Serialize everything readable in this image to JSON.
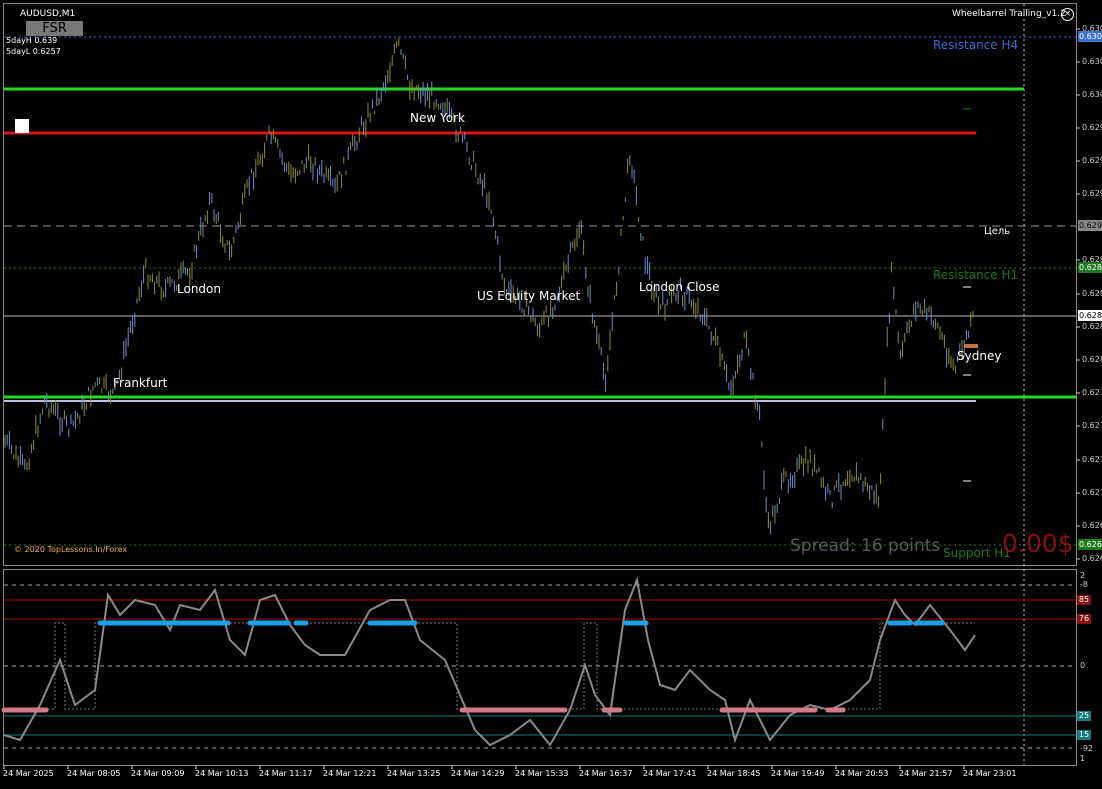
{
  "symbol": "AUDUSD,M1",
  "fsr_button": "FSR",
  "day_info": [
    "5dayH 0.639",
    "5dayL 0.6257"
  ],
  "ea": {
    "title": "Wheelbarrel Trailing_v1.2",
    "close_glyph": "×"
  },
  "levels": {
    "resistance_h4": "Resistance H4",
    "target": "Цель",
    "resistance_h1": "Resistance H1",
    "support_h1": "Support H1"
  },
  "sessions": [
    "New York",
    "London",
    "US Equity Market",
    "London Close",
    "Frankfurt",
    "Sydney"
  ],
  "copyright": "© 2020 TopLessons.In/Forex",
  "spread_text": "Spread: 16 points",
  "profit_text": "0.00$",
  "price_scale": [
    "0.630",
    "0.630",
    "0.630",
    "0.629",
    "0.629",
    "0.629",
    "0.628",
    "0.628",
    "0.628",
    "0.628",
    "0.627",
    "0.627",
    "0.627",
    "0.627",
    "0.626",
    "0.626"
  ],
  "price_tags": {
    "resistance_h4": "0.630",
    "target": "0.629",
    "resistance_h1": "0.628",
    "bid": "0.628",
    "support_h1": "0.626"
  },
  "indicator_scale": [
    "2",
    "-8",
    "0",
    "-92",
    "1"
  ],
  "indicator_levels": [
    "85",
    "76",
    "25",
    "15"
  ],
  "time_labels": [
    "24 Mar 2025",
    "24 Mar 08:05",
    "24 Mar 09:09",
    "24 Mar 10:13",
    "24 Mar 11:17",
    "24 Mar 12:21",
    "24 Mar 13:25",
    "24 Mar 14:29",
    "24 Mar 15:33",
    "24 Mar 16:37",
    "24 Mar 17:41",
    "24 Mar 18:45",
    "24 Mar 19:49",
    "24 Mar 20:53",
    "24 Mar 21:57",
    "24 Mar 23:01"
  ],
  "colors": {
    "background": "#000000",
    "candle_up": "#6b8fd4",
    "candle_down": "#8e8e2c",
    "green_line": "#22dd22",
    "red_line": "#dd1111",
    "resistance_h4": "#3a6ed6",
    "support_resistance_h1": "#1c7a1c",
    "oscillator": "#8a8a8a",
    "overbought_mark": "#1aa0e6",
    "oversold_mark": "#d07a8a"
  }
}
